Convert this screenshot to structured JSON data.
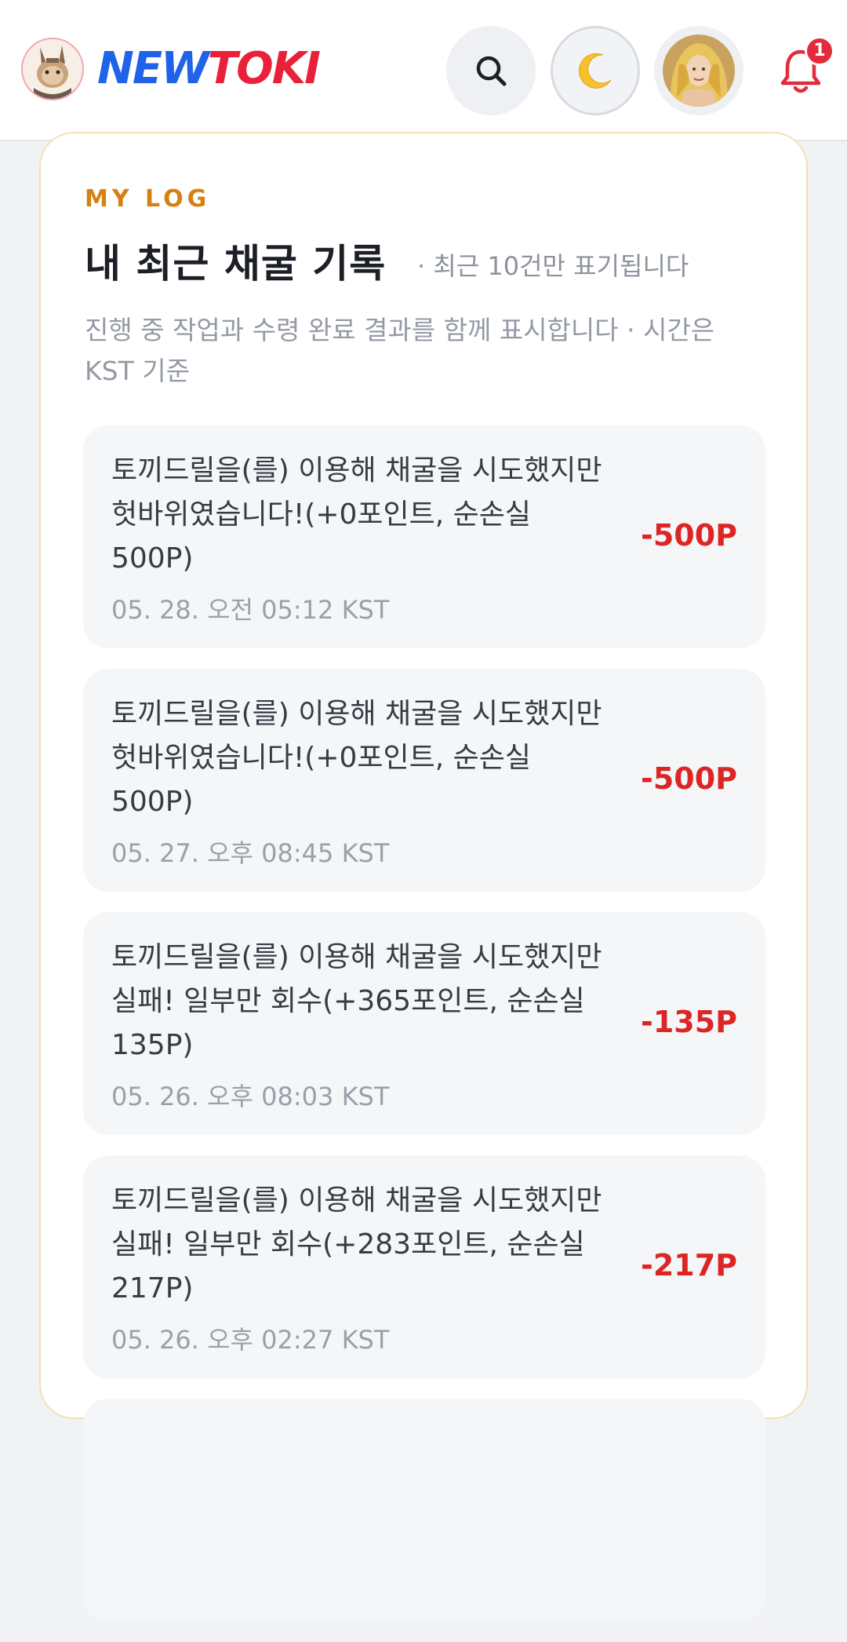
{
  "header": {
    "logo_new": "NEW",
    "logo_toki": "TOKI",
    "notification_count": "1",
    "icons": {
      "search": "search-icon",
      "theme": "moon-icon",
      "profile": "avatar",
      "notifications": "bell-icon"
    },
    "colors": {
      "logo_blue": "#1f63e8",
      "logo_red": "#e8203a",
      "badge": "#e32b3b"
    }
  },
  "card": {
    "eyebrow": "MY LOG",
    "title": "내 최근 채굴 기록",
    "title_note": "· 최근 10건만 표기됩니다",
    "description": "진행 중 작업과 수령 완료 결과를 함께 표시합니다 · 시간은 KST 기준",
    "accent_color": "#d6800f",
    "loss_color": "#dc2626",
    "logs": [
      {
        "message": "토끼드릴을(를) 이용해 채굴을 시도했지만 헛바위였습니다!(+0포인트, 순손실 500P)",
        "time": "05. 28. 오전 05:12 KST",
        "amount": "-500P"
      },
      {
        "message": "토끼드릴을(를) 이용해 채굴을 시도했지만 헛바위였습니다!(+0포인트, 순손실 500P)",
        "time": "05. 27. 오후 08:45 KST",
        "amount": "-500P"
      },
      {
        "message": "토끼드릴을(를) 이용해 채굴을 시도했지만 실패! 일부만 회수(+365포인트, 순손실 135P)",
        "time": "05. 26. 오후 08:03 KST",
        "amount": "-135P"
      },
      {
        "message": "토끼드릴을(를) 이용해 채굴을 시도했지만 실패! 일부만 회수(+283포인트, 순손실 217P)",
        "time": "05. 26. 오후 02:27 KST",
        "amount": "-217P"
      }
    ]
  }
}
